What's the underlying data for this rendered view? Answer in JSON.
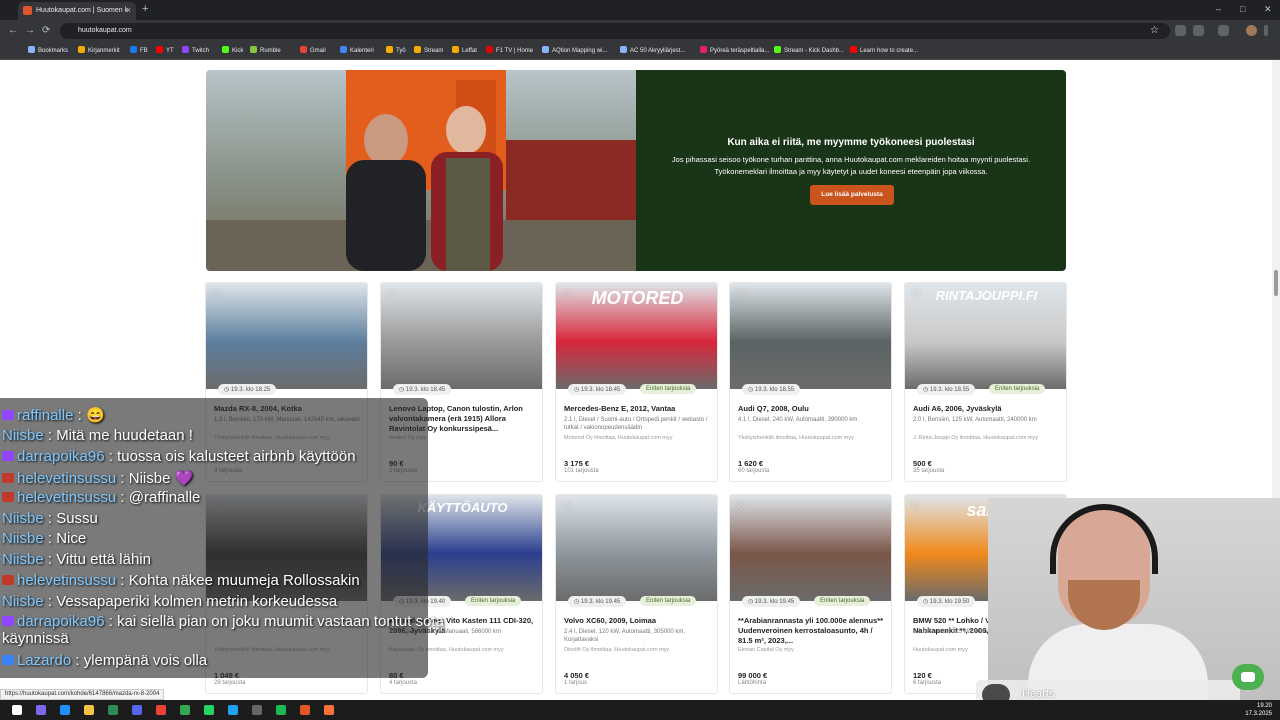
{
  "browser": {
    "tab_title": "Huutokaupat.com | Suomen k",
    "tab_close": "×",
    "new_tab": "+",
    "url": "huutokaupat.com",
    "window_controls": [
      "–",
      "□",
      "✕"
    ],
    "nav": [
      "←",
      "→",
      "⟳"
    ],
    "star": "☆"
  },
  "bookmarks": [
    {
      "label": "Bookmarks",
      "color": "#8ab4f8"
    },
    {
      "label": "Kirjanmerkit",
      "color": "#f9ab00"
    },
    {
      "label": "FB",
      "color": "#1877f2"
    },
    {
      "label": "YT",
      "color": "#ff0000"
    },
    {
      "label": "Twitch",
      "color": "#9146ff"
    },
    {
      "label": "Kick",
      "color": "#53fc18"
    },
    {
      "label": "Rumble",
      "color": "#85c742"
    },
    {
      "label": "Gmail",
      "color": "#ea4335"
    },
    {
      "label": "Kalenteri",
      "color": "#4285f4"
    },
    {
      "label": "Työ",
      "color": "#f9ab00"
    },
    {
      "label": "Stream",
      "color": "#f9ab00"
    },
    {
      "label": "Leffat",
      "color": "#f9ab00"
    },
    {
      "label": "F1 TV | Home",
      "color": "#e10600"
    },
    {
      "label": "AQtion Mapping wi...",
      "color": "#8ab4f8"
    },
    {
      "label": "AC 50 Akryyliärjest...",
      "color": "#8ab4f8"
    },
    {
      "label": "Pyöreä teräspeltialla...",
      "color": "#e91e63"
    },
    {
      "label": "Stream - Kick Dashb...",
      "color": "#53fc18"
    },
    {
      "label": "Learn how to create...",
      "color": "#ff0000"
    }
  ],
  "hero": {
    "title": "Kun aika ei riitä, me myymme työkoneesi puolestasi",
    "text": "Jos pihassasi seisoo työkone turhan panttina, anna Huutokaupat.com meklareiden hoitaa myynti puolestasi. Työkonemeklari ilmoittaa ja myy käytetyt ja uudet koneesi eteenpäin jopa viikossa.",
    "button": "Lue lisää palvelusta"
  },
  "listings": [
    {
      "title": "Mazda RX-8, 2004, Kotka",
      "specs": "1.3 l, Bensiini, 170 kW, Manuaali, 142040 km, takaveto",
      "seller": "Yksityishenkilö ilmoittaa, Huutokaupat.com myy",
      "time": "◷ 19.3. klo 18.25",
      "offer": "",
      "price": "",
      "bids": "3 tarjousta",
      "brand": "",
      "img": "#5d7f9e"
    },
    {
      "title": "Lenovo Laptop, Canon tulostin, Arlon valvontakamera (erä 1915) Allora Ravintolat Oy konkurssipesä...",
      "specs": "",
      "seller": "Realmi Oy myy",
      "time": "◷ 19.3. klo 18.45",
      "offer": "",
      "price": "90 €",
      "bids": "2 tarjousta",
      "brand": "",
      "img": "#9a9a9a"
    },
    {
      "title": "Mercedes-Benz E, 2012, Vantaa",
      "specs": "2.1 l, Diesel / Suomi-auto / Ortopedi penkit / webasto / tutkat / vakionopeudensäädin",
      "seller": "Motored Oy ilmoittaa, Huutokaupat.com myy",
      "time": "◷ 19.3. klo 18.45",
      "offer": "Eniten tarjouksia",
      "price": "3 175 €",
      "bids": "101 tarjousta",
      "brand": "MOTORED",
      "img": "#d8263a"
    },
    {
      "title": "Audi Q7, 2008, Oulu",
      "specs": "4.1 l, Diesel, 240 kW, Automaatti, 390000 km",
      "seller": "Yksityishenkilö ilmoittaa, Huutokaupat.com myy",
      "time": "◷ 19.3. klo 18.55",
      "offer": "",
      "price": "1 620 €",
      "bids": "60 tarjousta",
      "brand": "",
      "img": "#5b6364"
    },
    {
      "title": "Audi A6, 2006, Jyväskylä",
      "specs": "2.0 l, Bensiini, 125 kW, Automaatti, 240000 km",
      "seller": "J. Rinta-Jouppi Oy ilmoittaa, Huutokaupat.com myy",
      "time": "◷ 19.3. klo 18.55",
      "offer": "Eniten tarjouksia",
      "price": "500 €",
      "bids": "35 tarjousta",
      "brand": "RINTAJOUPPI.FI",
      "img": "#c9c9c9"
    },
    {
      "title": "",
      "specs": "",
      "seller": "Yksityishenkilö ilmoittaa, Huutokaupat.com myy",
      "time": "",
      "offer": "",
      "price": "1 049 €",
      "bids": "28 tarjousta",
      "brand": "",
      "img": "#3a3d42"
    },
    {
      "title": "Mercedes-Benz Vito Kasten 111 CDI-320, 2006, Jyväskylä",
      "specs": "2.1 l, Diesel, 80 kW, Manuaali, 586000 km",
      "seller": "Käyttöauto Oy ilmoittaa, Huutokaupat.com myy",
      "time": "◷ 19.3. klo 19.40",
      "offer": "Eniten tarjouksia",
      "price": "80 €",
      "bids": "4 tarjousta",
      "brand": "KÄYTTÖAUTO",
      "img": "#2b3f8e"
    },
    {
      "title": "Volvo XC60, 2009, Loimaa",
      "specs": "2.4 l, Diesel, 120 kW, Automaatti, 305000 km, Korjattavaksi",
      "seller": "Dinolift Oy ilmoittaa, Huutokaupat.com myy",
      "time": "◷ 19.3. klo 19.45",
      "offer": "Eniten tarjouksia",
      "price": "4 050 €",
      "bids": "1 tarjous",
      "brand": "",
      "img": "#8d969c"
    },
    {
      "title": "**Arabianrannasta yli 100.000e alennus** Uudenveroinen kerrostaloasunto, 4h / 81.5 m², 2023,...",
      "specs": "",
      "seller": "Ekman Capital Oy myy",
      "time": "◷ 19.3. klo 19.45",
      "offer": "Eniten tarjouksia",
      "price": "99 000 €",
      "bids": "Lähtöhinta",
      "brand": "",
      "img": "#7a5648"
    },
    {
      "title": "BMW 520 ** Lohko / Vakkari / Nahkapenkit **, 2008, Seinäjoki",
      "specs": "2.0 l, Bensiini, 125 kW, Automaatti",
      "seller": "Huutokaupat.com myy",
      "time": "◷ 19.3. klo 19.50",
      "offer": "Eniten tarjouksia",
      "price": "120 €",
      "bids": "6 tarjousta",
      "brand": "saka",
      "img": "#f08a1c"
    }
  ],
  "chat": [
    {
      "user": "raffinalle",
      "text": " : 😄",
      "badge": "#9147ff"
    },
    {
      "user": "Niisbe",
      "text": " : Mitä me huudetaan !",
      "badge": ""
    },
    {
      "user": "darrapoika96",
      "text": " : tuossa ois kalusteet airbnb käyttöön",
      "badge": "#9147ff"
    },
    {
      "user": "helevetinsussu",
      "text": " : Niisbe 💜",
      "badge": "#c0392b"
    },
    {
      "user": "helevetinsussu",
      "text": " : @raffinalle",
      "badge": "#c0392b"
    },
    {
      "user": "Niisbe",
      "text": " : Sussu",
      "badge": ""
    },
    {
      "user": "Niisbe",
      "text": " : Nice",
      "badge": ""
    },
    {
      "user": "Niisbe",
      "text": " : Vittu että lähin",
      "badge": ""
    },
    {
      "user": "helevetinsussu",
      "text": " : Kohta näkee muumeja Rollossakin",
      "badge": "#c0392b"
    },
    {
      "user": "Niisbe",
      "text": " : Vessapaperiki kolmen metrin korkeudessa",
      "badge": ""
    },
    {
      "user": "darrapoika96",
      "text": " : kai siellä pian on joku muumit vastaan tontut sota",
      "badge": "#9147ff"
    },
    {
      "user": "",
      "text": "käynnissä",
      "badge": ""
    },
    {
      "user": "Lazardo",
      "text": " : ylempänä vois olla",
      "badge": "#3b82f6"
    }
  ],
  "music": {
    "title": "Hearts"
  },
  "status_url": "https://huutokaupat.com/kohde/6147866/mazda-rx-8-2004",
  "clock": {
    "time": "19.20",
    "date": "17.3.2025"
  },
  "taskbar_icons": [
    {
      "color": "#ffffff"
    },
    {
      "color": "#7b68ee"
    },
    {
      "color": "#1e90ff"
    },
    {
      "color": "#f4c542"
    },
    {
      "color": "#2e8b57"
    },
    {
      "color": "#5865f2"
    },
    {
      "color": "#ea4335"
    },
    {
      "color": "#34a853"
    },
    {
      "color": "#25d366"
    },
    {
      "color": "#1da1f2"
    },
    {
      "color": "#666666"
    },
    {
      "color": "#1db954"
    },
    {
      "color": "#e25822"
    },
    {
      "color": "#ff7139"
    }
  ]
}
